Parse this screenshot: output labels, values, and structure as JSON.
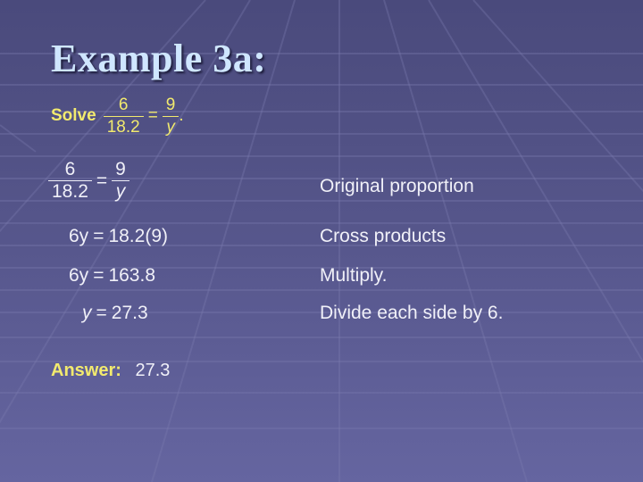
{
  "slide": {
    "title": "Example 3a:",
    "prompt": {
      "label": "Solve",
      "lhs_num": "6",
      "lhs_den": "18.2",
      "rhs_num": "9",
      "rhs_den": "y",
      "eq": "=",
      "period": "."
    },
    "steps": [
      {
        "lhs_num": "6",
        "lhs_den": "18.2",
        "eq": "=",
        "rhs_num": "9",
        "rhs_den": "y",
        "note": "Original proportion"
      },
      {
        "lhs": "6y",
        "eq": "=",
        "rhs": "18.2(9)",
        "note": "Cross products"
      },
      {
        "lhs": "6y",
        "eq": "=",
        "rhs": "163.8",
        "note": "Multiply."
      },
      {
        "lhs": "y",
        "eq": "=",
        "rhs": "27.3",
        "note": "Divide each side by 6."
      }
    ],
    "answer": {
      "label": "Answer:",
      "value": "27.3"
    },
    "colors": {
      "title": "#cfe6ff",
      "highlight": "#f2ea6e",
      "text": "#f0f0f8",
      "background": "#55558a"
    }
  }
}
